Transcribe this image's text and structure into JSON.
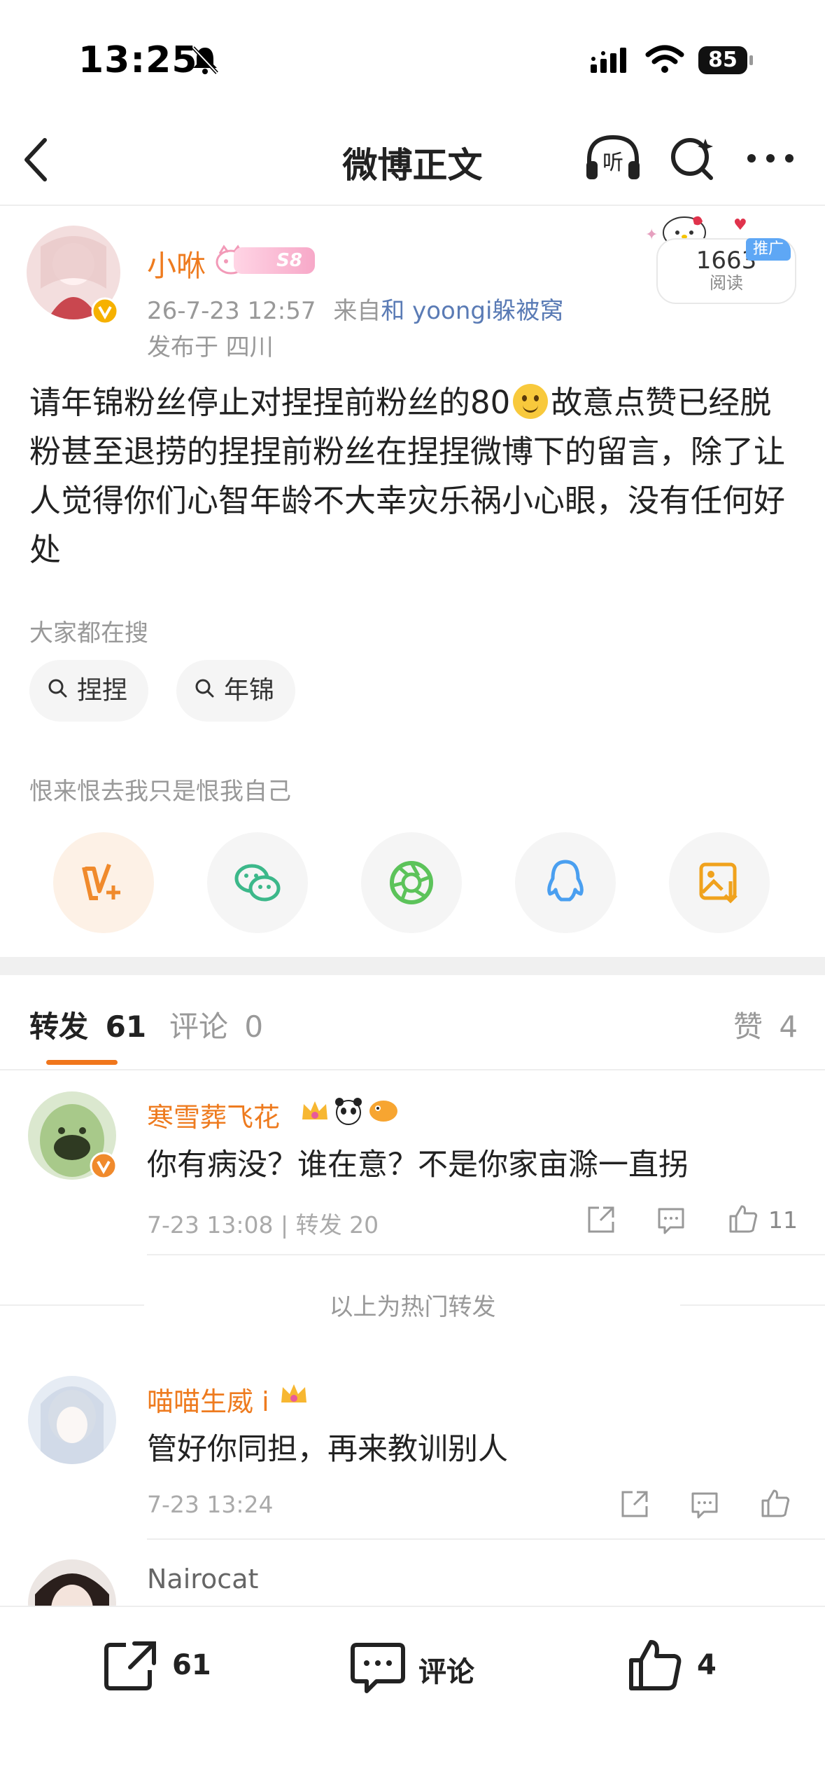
{
  "status": {
    "time": "13:25",
    "battery": "85"
  },
  "nav": {
    "title": "微博正文"
  },
  "post": {
    "username": "小咻",
    "level": "S8",
    "timestamp": "26-7-23 12:57",
    "source_prefix": "来自",
    "source": "和 yoongi躲被窝",
    "location": "发布于 四川",
    "reads": "1663",
    "reads_label": "阅读",
    "promo": "推广",
    "text_part1": "请年锦粉丝停止对捏捏前粉丝的80",
    "text_part2": "故意点赞已经脱粉甚至退捞的捏捏前粉丝在捏捏微博下的留言，除了让人觉得你们心智年龄不大幸灾乐祸小心眼，没有任何好处"
  },
  "search": {
    "label": "大家都在搜",
    "chips": [
      "捏捏",
      "年锦"
    ]
  },
  "share": {
    "label": "恨来恨去我只是恨我自己"
  },
  "tabs": {
    "repost_label": "转发",
    "repost_count": "61",
    "comment_label": "评论",
    "comment_count": "0",
    "like_label": "赞",
    "like_count": "4"
  },
  "reposts": [
    {
      "name": "寒雪葬飞花",
      "text": "你有病没？谁在意？不是你家亩滁一直拐",
      "meta": "7-23 13:08 | 转发 20",
      "likes": "11"
    },
    {
      "name": "喵喵生威 i",
      "text": "管好你同担，再来教训别人",
      "meta": "7-23 13:24",
      "likes": ""
    },
    {
      "name": "Nairocat",
      "text": "",
      "meta": "",
      "likes": ""
    }
  ],
  "hot_label": "以上为热门转发",
  "bottom": {
    "repost": "61",
    "comment": "评论",
    "like": "4"
  },
  "colors": {
    "accent": "#ee7b1f",
    "link": "#5a7bb5",
    "tab_underline": "#f0761c"
  }
}
